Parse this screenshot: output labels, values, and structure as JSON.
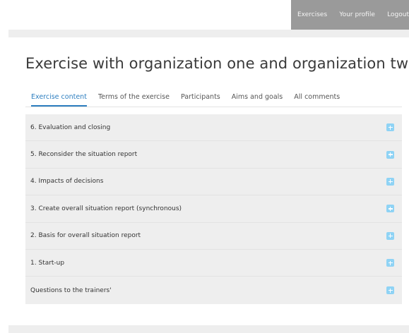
{
  "topnav": {
    "items": [
      {
        "label": "Exercises"
      },
      {
        "label": "Your profile"
      },
      {
        "label": "Logout"
      }
    ]
  },
  "page": {
    "title": "Exercise with organization one and organization two"
  },
  "tabs": [
    {
      "label": "Exercise content",
      "active": true
    },
    {
      "label": "Terms of the exercise",
      "active": false
    },
    {
      "label": "Participants",
      "active": false
    },
    {
      "label": "Aims and goals",
      "active": false
    },
    {
      "label": "All comments",
      "active": false
    }
  ],
  "accordion": {
    "items": [
      {
        "label": "6. Evaluation and closing",
        "icon": "plus-icon"
      },
      {
        "label": "5. Reconsider the situation report",
        "icon": "plus-icon"
      },
      {
        "label": "4. Impacts of decisions",
        "icon": "plus-icon"
      },
      {
        "label": "3. Create overall situation report (synchronous)",
        "icon": "plus-icon"
      },
      {
        "label": "2. Basis for overall situation report",
        "icon": "plus-icon"
      },
      {
        "label": "1. Start-up",
        "icon": "plus-icon"
      },
      {
        "label": "Questions to the trainers'",
        "icon": "plus-icon"
      }
    ]
  },
  "colors": {
    "nav_background": "#9a9a9a",
    "active_tab": "#2e7fc0",
    "expand_icon": "#8fd3f5",
    "panel_background": "#eeeeee"
  }
}
